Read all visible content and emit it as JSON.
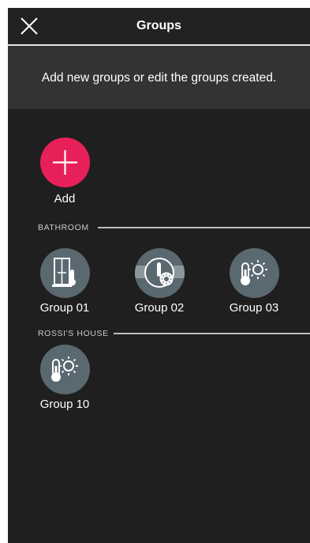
{
  "header": {
    "title": "Groups",
    "close_icon": "close-icon"
  },
  "banner": {
    "text": "Add new groups or edit the groups created."
  },
  "add": {
    "label": "Add",
    "icon": "plus-icon",
    "color": "#e8205a"
  },
  "sections": [
    {
      "title": "BATHROOM",
      "groups": [
        {
          "label": "Group 01",
          "icon": "window-thermometer-icon"
        },
        {
          "label": "Group 02",
          "icon": "shutter-sun-icon"
        },
        {
          "label": "Group 03",
          "icon": "thermometer-sun-icon"
        }
      ]
    },
    {
      "title": "ROSSI'S HOUSE",
      "groups": [
        {
          "label": "Group 10",
          "icon": "thermometer-sun-icon"
        }
      ]
    }
  ]
}
